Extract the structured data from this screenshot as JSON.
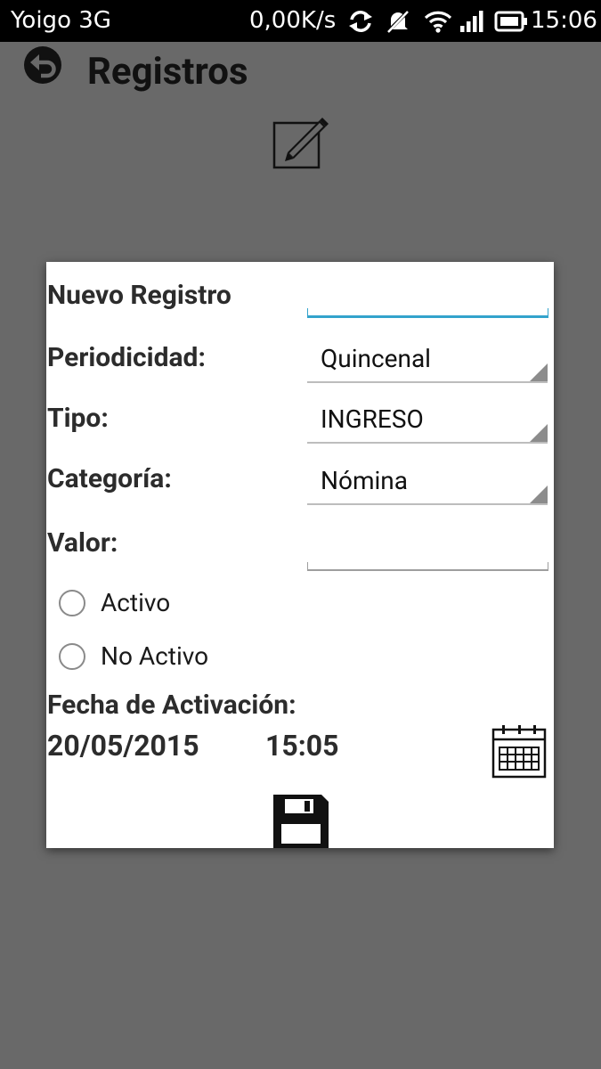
{
  "status_bar": {
    "carrier": "Yoigo 3G",
    "speed": "0,00K/s",
    "time": "15:06",
    "icons": [
      "sync-icon",
      "notifications-off-icon",
      "wifi-icon",
      "signal-icon",
      "battery-icon"
    ]
  },
  "header": {
    "title": "Registros",
    "back_icon": "back-arrow-icon",
    "edit_icon": "edit-pencil-icon"
  },
  "dialog": {
    "new_record_label": "Nuevo Registro",
    "new_record_value": "",
    "periodicity_label": "Periodicidad:",
    "periodicity_value": "Quincenal",
    "type_label": "Tipo:",
    "type_value": "INGRESO",
    "category_label": "Categoría:",
    "category_value": "Nómina",
    "value_label": "Valor:",
    "value_value": "",
    "radio_active": "Activo",
    "radio_inactive": "No Activo",
    "activation_date_label": "Fecha de Activación:",
    "activation_date": "20/05/2015",
    "activation_time": "15:05",
    "calendar_icon": "calendar-icon",
    "save_icon": "save-floppy-icon"
  },
  "colors": {
    "background": "#696969",
    "status_bar": "#000000",
    "dialog": "#ffffff",
    "focus_accent": "#33a3cc"
  }
}
